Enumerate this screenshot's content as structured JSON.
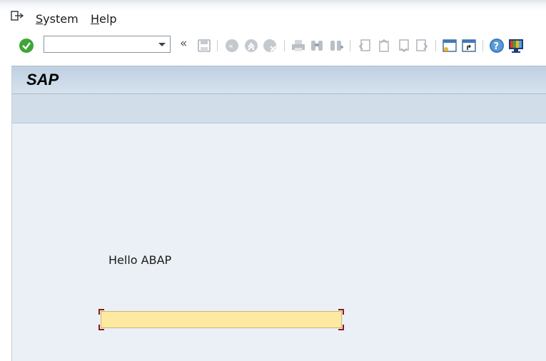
{
  "menu": {
    "items": [
      {
        "label": "System",
        "mnemonic": "S"
      },
      {
        "label": "Help",
        "mnemonic": "H"
      }
    ]
  },
  "toolbar": {
    "command_field": {
      "value": "",
      "placeholder": ""
    },
    "icons": [
      "enter-icon",
      "command-dropdown-icon",
      "collapse-toolbar-icon",
      "save-icon",
      "back-icon",
      "exit-icon",
      "cancel-icon",
      "print-icon",
      "find-icon",
      "find-next-icon",
      "first-page-icon",
      "previous-page-icon",
      "next-page-icon",
      "last-page-icon",
      "new-session-icon",
      "shortcut-icon",
      "help-icon",
      "customize-layout-icon"
    ]
  },
  "screen": {
    "title": "SAP",
    "text_label": "Hello ABAP",
    "input_field": {
      "value": "",
      "placeholder": ""
    }
  },
  "colors": {
    "accent_green": "#3fa535",
    "input_highlight": "#fdeaa0",
    "title_bar": "#c8d7e7",
    "background": "#ebf0f6"
  }
}
